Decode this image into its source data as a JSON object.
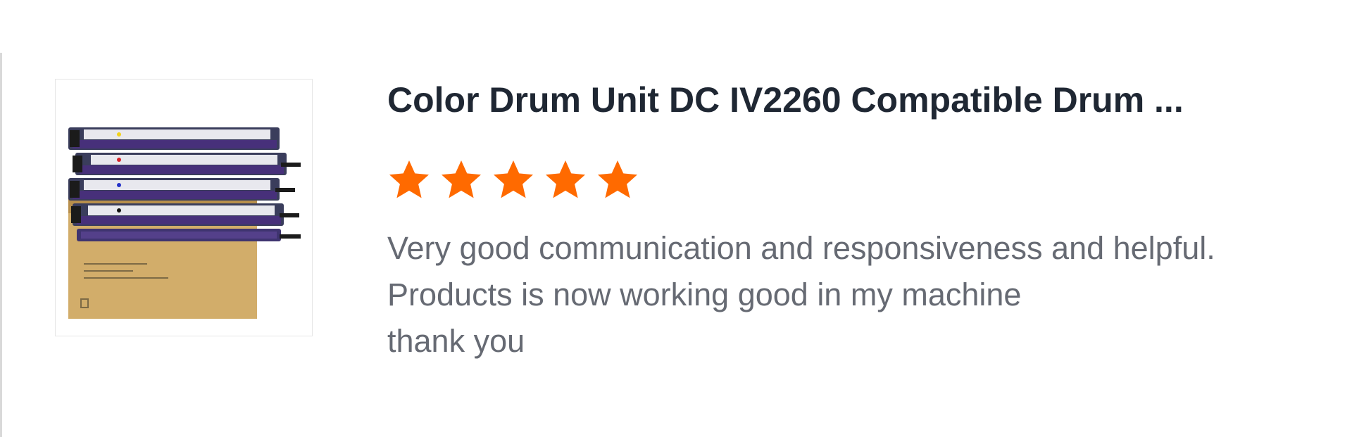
{
  "review": {
    "product_title": "Color Drum Unit DC IV2260 Compatible Drum ...",
    "rating": 5,
    "rating_max": 5,
    "star_color": "#ff6a00",
    "text_lines": [
      "Very good communication and responsiveness and helpful.",
      "Products is now working good in my machine",
      "thank you"
    ]
  }
}
